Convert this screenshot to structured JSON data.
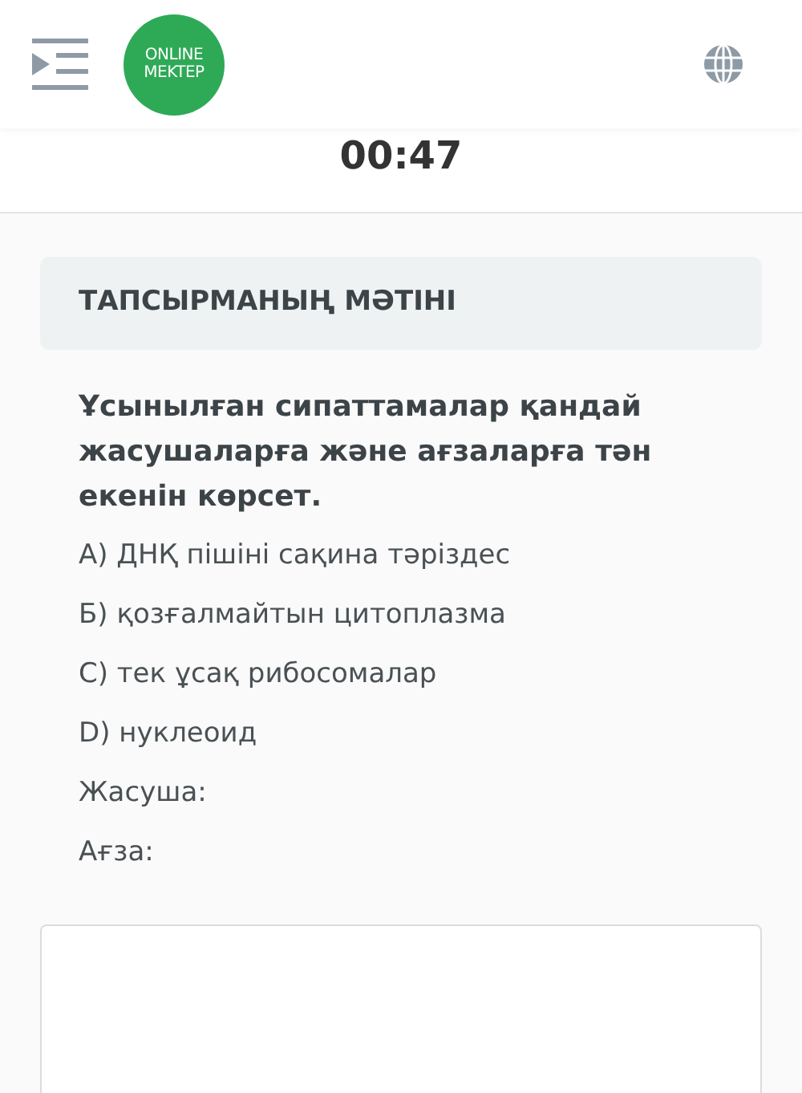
{
  "header": {
    "logo": [
      "ONLINE",
      "MEKTEP"
    ]
  },
  "timer": "00:47",
  "task": {
    "title": "ТАПСЫРМАНЫҢ МӘТІНІ",
    "question": "Ұсынылған сипаттамалар қандай жасушаларға және ағзаларға тән екенін көрсет.",
    "lines": [
      "А) ДНҚ пішіні сақина тәріздес",
      "Б) қозғалмайтын цитоплазма",
      "С) тек ұсақ рибосомалар",
      "D) нуклеоид",
      "Жасуша:",
      "Ағза:"
    ]
  }
}
